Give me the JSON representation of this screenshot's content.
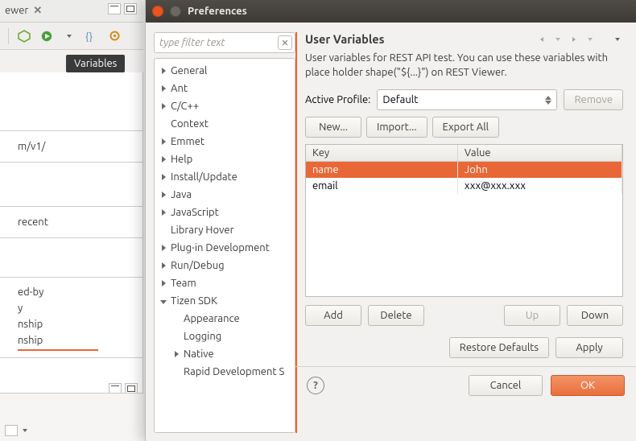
{
  "ide": {
    "view_tab": "ewer",
    "tooltip": "Variables",
    "left_url": "m/v1/",
    "recent_label": "recent",
    "list_items": [
      "ed-by",
      "y",
      "nship",
      "nship"
    ]
  },
  "dialog": {
    "title": "Preferences",
    "filter_placeholder": "type filter text",
    "tree": [
      {
        "label": "General",
        "expand": "r"
      },
      {
        "label": "Ant",
        "expand": "r"
      },
      {
        "label": "C/C++",
        "expand": "r"
      },
      {
        "label": "Context",
        "expand": ""
      },
      {
        "label": "Emmet",
        "expand": "r"
      },
      {
        "label": "Help",
        "expand": "r"
      },
      {
        "label": "Install/Update",
        "expand": "r"
      },
      {
        "label": "Java",
        "expand": "r"
      },
      {
        "label": "JavaScript",
        "expand": "r"
      },
      {
        "label": "Library Hover",
        "expand": ""
      },
      {
        "label": "Plug-in Development",
        "expand": "r"
      },
      {
        "label": "Run/Debug",
        "expand": "r"
      },
      {
        "label": "Team",
        "expand": "r"
      },
      {
        "label": "Tizen SDK",
        "expand": "d"
      },
      {
        "label": "Appearance",
        "expand": "",
        "indent": 1
      },
      {
        "label": "Logging",
        "expand": "",
        "indent": 1
      },
      {
        "label": "Native",
        "expand": "r",
        "indent": 1
      },
      {
        "label": "Rapid Development S",
        "expand": "",
        "indent": 1
      }
    ],
    "page": {
      "heading": "User Variables",
      "description": "User variables for REST API test. You can use these variables with place holder shape(\"${...}\") on REST Viewer.",
      "active_profile_label": "Active Profile:",
      "active_profile_value": "Default",
      "remove_label": "Remove",
      "new_label": "New...",
      "import_label": "Import...",
      "export_label": "Export All",
      "col_key": "Key",
      "col_value": "Value",
      "rows": [
        {
          "key": "name",
          "value": "John",
          "sel": true
        },
        {
          "key": "email",
          "value": "xxx@xxx.xxx",
          "sel": false
        }
      ],
      "add_label": "Add",
      "delete_label": "Delete",
      "up_label": "Up",
      "down_label": "Down",
      "restore_label": "Restore Defaults",
      "apply_label": "Apply",
      "cancel_label": "Cancel",
      "ok_label": "OK"
    }
  }
}
